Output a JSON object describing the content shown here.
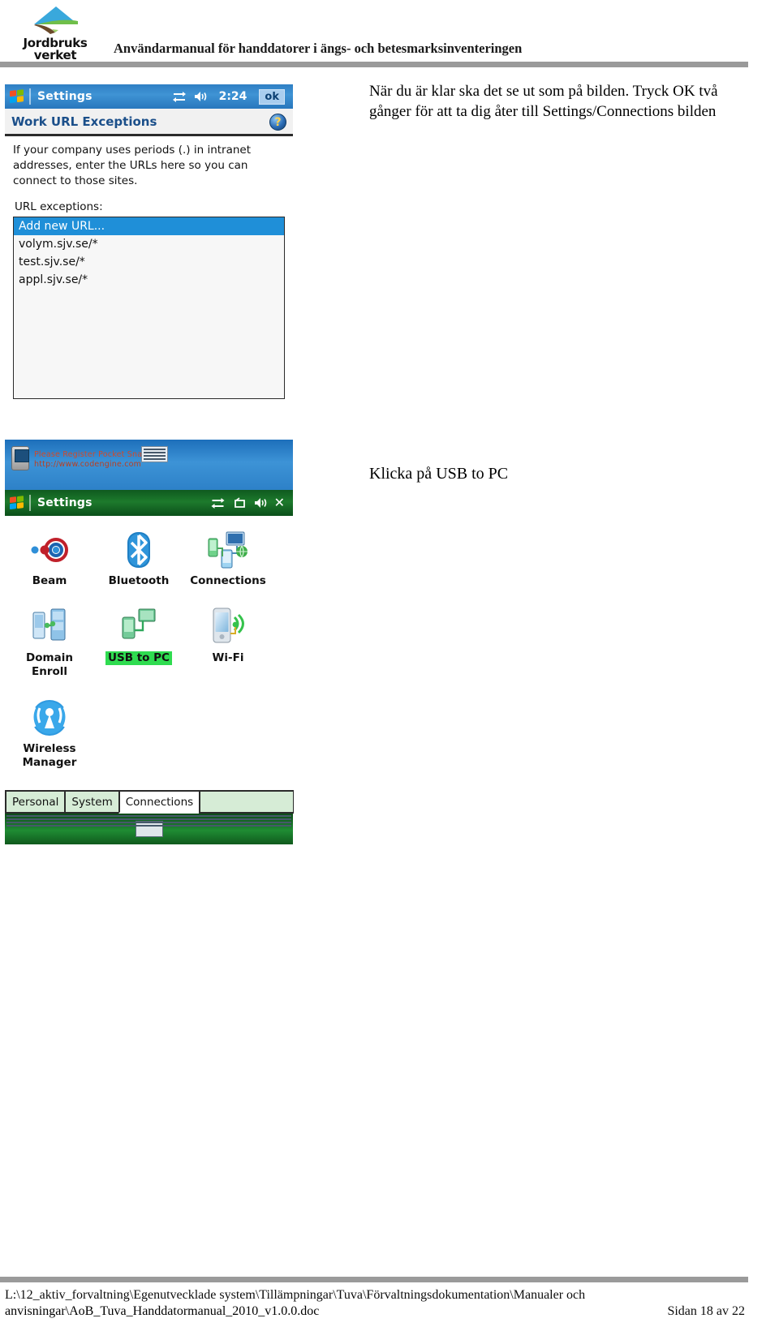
{
  "header": {
    "logo_line1": "Jordbruks",
    "logo_line2": "verket",
    "logo_icon": "jordbruksverket-logo",
    "title": "Användarmanual för handdatorer i ängs- och betesmarksinventeringen"
  },
  "instructions": {
    "first": "När du är klar ska det se ut som på bilden. Tryck OK två gånger för att ta dig åter till Settings/Connections bilden",
    "second": "Klicka på USB to PC"
  },
  "screen1": {
    "titlebar": {
      "start_icon": "windows-flag-icon",
      "app_title": "Settings",
      "connectivity_icon": "connectivity-icon",
      "volume_icon": "speaker-icon",
      "clock": "2:24",
      "ok_button": "ok"
    },
    "page_title": "Work URL Exceptions",
    "help_icon": "help-question-icon",
    "blurb": "If your company uses periods (.) in intranet addresses, enter the URLs here so you can connect to those sites.",
    "list_label": "URL exceptions:",
    "list_items": [
      {
        "text": "Add new URL...",
        "selected": true
      },
      {
        "text": "volym.sjv.se/*",
        "selected": false
      },
      {
        "text": "test.sjv.se/*",
        "selected": false
      },
      {
        "text": "appl.sjv.se/*",
        "selected": false
      }
    ]
  },
  "watermark": {
    "device_icon": "pda-device-icon",
    "line1": "Please Register Pocket Snapshot",
    "line2": "http://www.codengine.com",
    "keyboard_icon": "keyboard-icon"
  },
  "screen2": {
    "titlebar": {
      "start_icon": "windows-flag-icon",
      "app_title": "Settings",
      "connectivity_icon": "connectivity-icon",
      "rotate_icon": "rotate-screen-icon",
      "volume_icon": "speaker-icon",
      "close_label": "✕"
    },
    "icons": [
      {
        "label": "Beam",
        "icon": "beam-icon",
        "highlighted": false
      },
      {
        "label": "Bluetooth",
        "icon": "bluetooth-icon",
        "highlighted": false
      },
      {
        "label": "Connections",
        "icon": "connections-icon",
        "highlighted": false
      },
      {
        "label": "Domain\nEnroll",
        "icon": "domain-enroll-icon",
        "highlighted": false
      },
      {
        "label": "USB to PC",
        "icon": "usb-to-pc-icon",
        "highlighted": true
      },
      {
        "label": "Wi-Fi",
        "icon": "wifi-icon",
        "highlighted": false
      },
      {
        "label": "Wireless\nManager",
        "icon": "wireless-manager-icon",
        "highlighted": false
      }
    ],
    "tabs": [
      {
        "label": "Personal",
        "active": false
      },
      {
        "label": "System",
        "active": false
      },
      {
        "label": "Connections",
        "active": true
      }
    ],
    "sip_icon": "keyboard-icon"
  },
  "footer": {
    "path": "L:\\12_aktiv_forvaltning\\Egenutvecklade system\\Tillämpningar\\Tuva\\Förvaltningsdokumentation\\Manualer och anvisningar\\AoB_Tuva_Handdatormanual_2010_v1.0.0.doc",
    "page": "Sidan 18 av 22"
  },
  "colors": {
    "accent_blue": "#2f7fc4",
    "accent_green": "#0f5a1f",
    "selection_blue": "#1f8fd8",
    "highlight_green": "#2fdc50",
    "rule_gray": "#9a9a9a"
  }
}
